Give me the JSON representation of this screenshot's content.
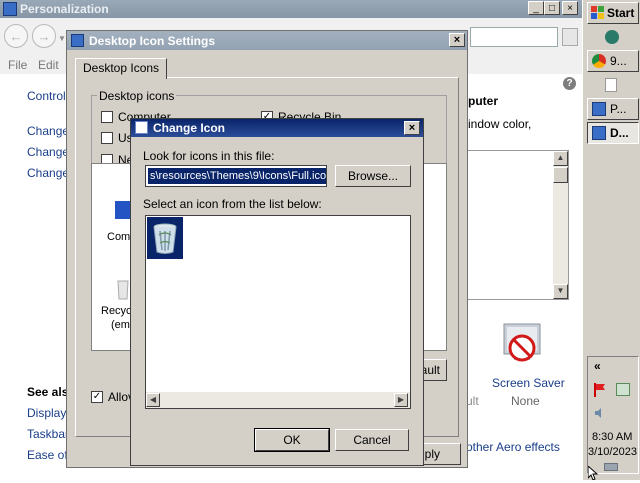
{
  "personalization": {
    "title": "Personalization",
    "nav": {
      "back": "←",
      "forward": "→"
    },
    "menu": [
      "File",
      "Edit"
    ],
    "left_links": [
      "Control",
      "Change",
      "Change",
      "Change"
    ],
    "see_also": {
      "heading": "See als",
      "links": [
        "Display",
        "Taskbar",
        "Ease of"
      ]
    },
    "right": {
      "heading": "puter",
      "desc": "indow color,",
      "screen_saver_label": "Screen Saver",
      "screen_saver_value": "None",
      "ult": "ult",
      "aero_link": "other Aero effects"
    },
    "help": "?",
    "caption_buttons": {
      "minimize": "_",
      "maximize": "□",
      "close": "×"
    }
  },
  "desktop_icon_settings": {
    "title": "Desktop Icon Settings",
    "tab": "Desktop Icons",
    "group_label": "Desktop icons",
    "checkboxes": [
      {
        "label": "Computer",
        "checked": false
      },
      {
        "label": "Us",
        "checked": false
      },
      {
        "label": "Ne",
        "checked": false
      },
      {
        "label": "Recycle Bin",
        "checked": true
      }
    ],
    "icons": [
      {
        "label": "Comp"
      },
      {
        "label": "Recyc"
      },
      {
        "label": "(em"
      }
    ],
    "allow_label": "Allov",
    "allow_checked": true,
    "restore_default_partial": "ault",
    "apply_partial": "ply",
    "close": "×"
  },
  "change_icon": {
    "title": "Change Icon",
    "look_label": "Look for icons in this file:",
    "path_value": "s\\resources\\Themes\\9\\Icons\\Full.ico",
    "browse_label": "Browse...",
    "select_label": "Select an icon from the list below:",
    "ok_label": "OK",
    "cancel_label": "Cancel",
    "close": "×",
    "scroll_left": "◀",
    "scroll_right": "▶"
  },
  "taskbar": {
    "start_label": "Start",
    "buttons": [
      {
        "label": "9..."
      },
      {
        "label": "P..."
      },
      {
        "label": "D..."
      }
    ],
    "tray_arrow": "«",
    "time": "8:30 AM",
    "date": "3/10/2023"
  },
  "colors": {
    "title_active": "#0a246a",
    "title_inactive": "#93a2b2",
    "face": "#d4d0c8",
    "selection": "#0a246a"
  }
}
